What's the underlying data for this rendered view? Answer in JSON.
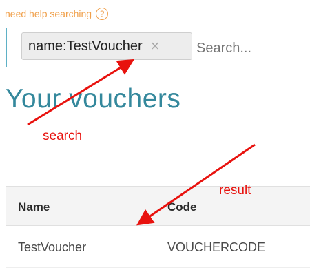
{
  "help": {
    "text": "need help searching",
    "icon_glyph": "?"
  },
  "search": {
    "tag_label": "name:TestVoucher",
    "tag_close_glyph": "×",
    "input_value": "",
    "placeholder": "Search..."
  },
  "page_title": "Your vouchers",
  "table": {
    "headers": [
      "Name",
      "Code"
    ],
    "rows": [
      [
        "TestVoucher",
        "VOUCHERCODE"
      ]
    ]
  },
  "annotations": {
    "search_label": "search",
    "result_label": "result",
    "color": "#e8120e"
  },
  "colors": {
    "accent": "#34889c",
    "help_orange": "#f0a04b",
    "search_border": "#5fb1c6"
  }
}
